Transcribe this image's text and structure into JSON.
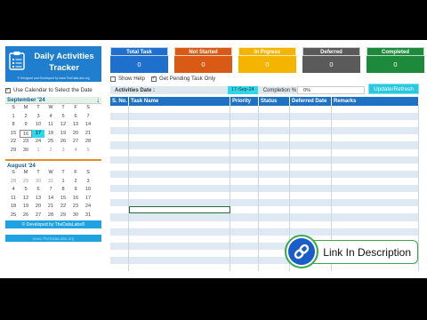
{
  "app": {
    "title": "Daily Activities Tracker",
    "subtitle": "© Designed and Developed by www.TheDataLabs.org"
  },
  "options": {
    "use_calendar_label": "Use Calendar to Select the Date",
    "use_calendar_checked": "✓",
    "show_help_label": "Show Help",
    "pending_only_label": "Get Pending Task Only",
    "pending_only_checked": "✓"
  },
  "calendars": [
    {
      "title": "September '24",
      "weekdays": [
        "S",
        "M",
        "T",
        "W",
        "T",
        "F",
        "S"
      ],
      "days": [
        "1",
        "2",
        "3",
        "4",
        "5",
        "6",
        "7",
        "8",
        "9",
        "10",
        "11",
        "12",
        "13",
        "14",
        "15",
        "16",
        "17",
        "18",
        "19",
        "20",
        "21",
        "22",
        "23",
        "24",
        "25",
        "26",
        "27",
        "28",
        "29",
        "30",
        "1",
        "2",
        "3",
        "4",
        "5"
      ],
      "selected": "17"
    },
    {
      "title": "August '24",
      "weekdays": [
        "S",
        "M",
        "T",
        "W",
        "T",
        "F",
        "S"
      ],
      "days": [
        "28",
        "29",
        "30",
        "31",
        "1",
        "2",
        "3",
        "4",
        "5",
        "6",
        "7",
        "8",
        "9",
        "10",
        "11",
        "12",
        "13",
        "14",
        "15",
        "16",
        "17",
        "18",
        "19",
        "20",
        "21",
        "22",
        "23",
        "24",
        "25",
        "26",
        "27",
        "28",
        "29",
        "30",
        "31"
      ]
    }
  ],
  "footer": {
    "developed_by": "© Developed by TheDataLabs®",
    "link": "www.TheDataLabs.org"
  },
  "status_cards": [
    {
      "title": "Total Task",
      "value": "0",
      "color": "#1f6fcc"
    },
    {
      "title": "Not Started",
      "value": "0",
      "color": "#d85a14"
    },
    {
      "title": "In Prgress",
      "value": "0",
      "color": "#f4b400"
    },
    {
      "title": "Deferred",
      "value": "0",
      "color": "#5a5a5a"
    },
    {
      "title": "Completed",
      "value": "0",
      "color": "#1c8a3a"
    }
  ],
  "activity": {
    "date_label": "Activities Date :",
    "date_value": "17-Sep-24",
    "completion_label": "Completion %",
    "completion_value": "0%",
    "refresh_label": "Update/Refresh"
  },
  "table": {
    "columns": [
      "S. No.",
      "Task Name",
      "Priority",
      "Status",
      "Deferred Date",
      "Remarks"
    ],
    "row_count": 23
  },
  "badge": {
    "label": "Link In Description"
  }
}
